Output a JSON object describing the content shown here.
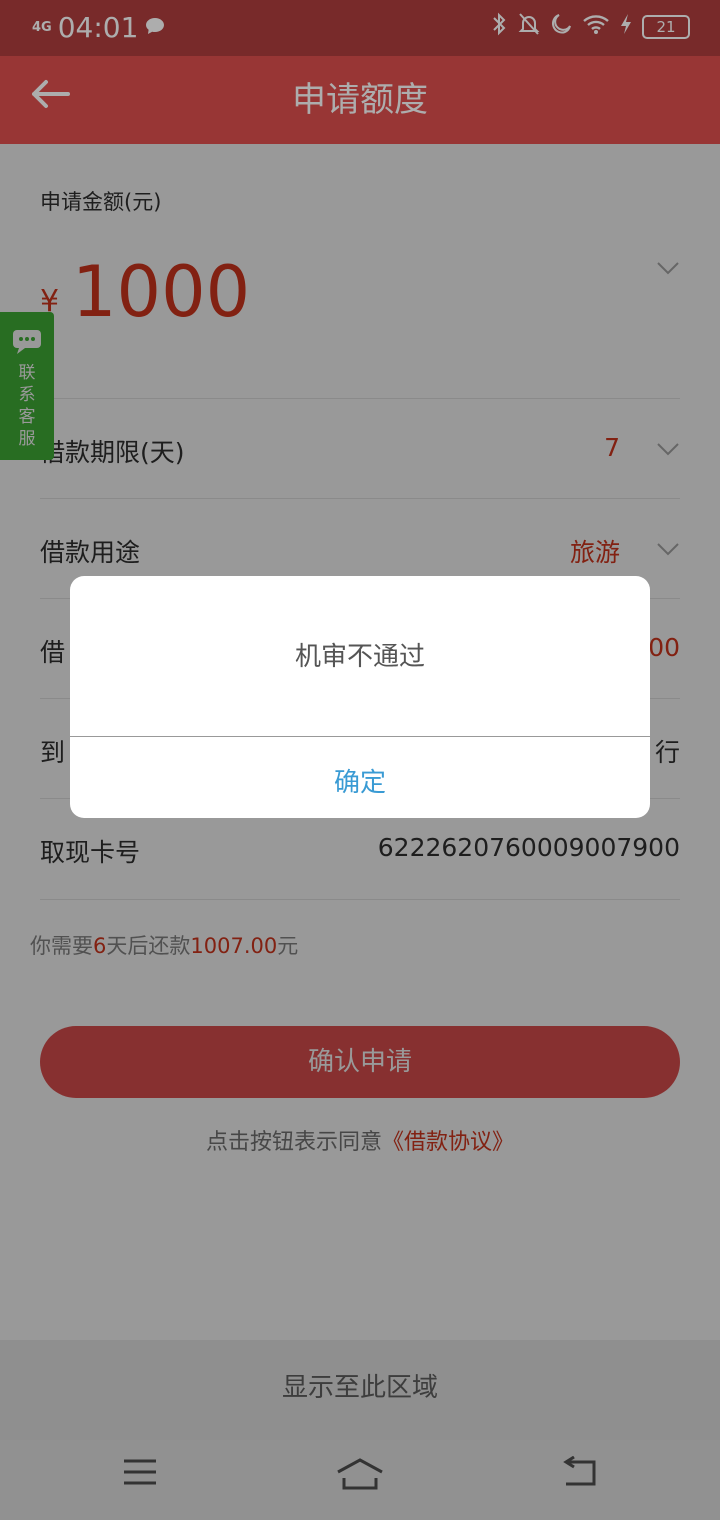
{
  "status_bar": {
    "network": "4G",
    "time": "04:01",
    "chat_icon": "chat-bubble-icon",
    "icons": [
      "bluetooth-icon",
      "bell-off-icon",
      "moon-icon",
      "wifi-icon",
      "charging-icon"
    ],
    "battery": "21"
  },
  "header": {
    "back_icon": "arrow-left-icon",
    "title": "申请额度"
  },
  "amount": {
    "label": "申请金额(元)",
    "currency": "¥",
    "value": "1000"
  },
  "rows": [
    {
      "label": "借款期限(天)",
      "value": "7"
    },
    {
      "label": "借款用途",
      "value": "旅游"
    },
    {
      "label": "借",
      "value": "00"
    },
    {
      "label": "到",
      "value": "行"
    },
    {
      "label": "取现卡号",
      "value": "6222620760009007900"
    }
  ],
  "side_tab": {
    "label_chars": [
      "联",
      "系",
      "客",
      "服"
    ]
  },
  "notice": {
    "prefix": "你需要",
    "days": "6",
    "middle": "天后还款",
    "amount": "1007.00",
    "suffix": "元"
  },
  "confirm_button": "确认申请",
  "agreement": {
    "prefix": "点击按钮表示同意",
    "link": "《借款协议》"
  },
  "show_area": "显示至此区域",
  "dialog": {
    "message": "机审不通过",
    "ok": "确定"
  },
  "colors": {
    "accent": "#e0504e",
    "value_red": "#d9381e",
    "ok_blue": "#3a9bd4",
    "side_green": "#44b63a"
  }
}
